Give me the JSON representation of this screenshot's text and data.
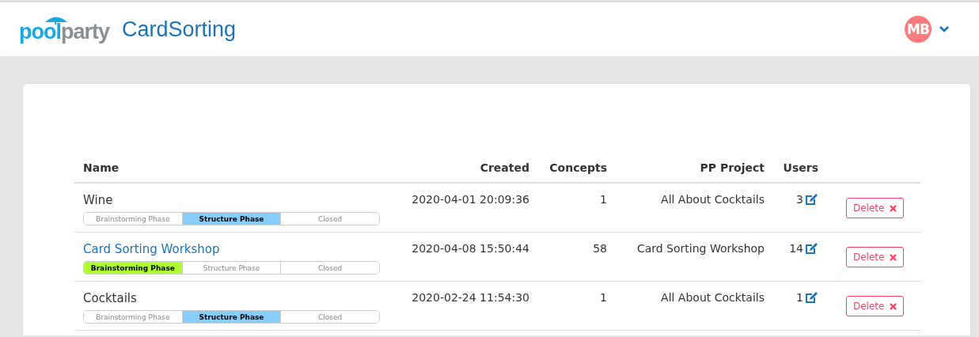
{
  "header": {
    "logo": {
      "part_1": "pool",
      "part_2": "party"
    },
    "app_title": "CardSorting",
    "user": {
      "initials": "MB"
    }
  },
  "table": {
    "columns": [
      "Name",
      "Created",
      "Concepts",
      "PP Project",
      "Users"
    ],
    "rows": [
      {
        "name": "Wine",
        "hovered": false,
        "created": "2020-04-01 20:09:36",
        "concepts": "1",
        "project": "All About Cocktails",
        "users": "3",
        "delete": "Delete",
        "color": "#87cefa",
        "phases": [
          {
            "label": "Brainstorming Phase",
            "selected": false
          },
          {
            "label": "Structure Phase",
            "selected": true
          },
          {
            "label": "Closed",
            "selected": false
          }
        ]
      },
      {
        "name": "Card Sorting Workshop",
        "hovered": true,
        "created": "2020-04-08 15:50:44",
        "concepts": "58",
        "project": "Card Sorting Workshop",
        "users": "14",
        "delete": "Delete",
        "color": "#adff2f",
        "phases": [
          {
            "label": "Brainstorming Phase",
            "selected": true
          },
          {
            "label": "Structure Phase",
            "selected": false
          },
          {
            "label": "Closed",
            "selected": false
          }
        ]
      },
      {
        "name": "Cocktails",
        "hovered": false,
        "created": "2020-02-24 11:54:30",
        "concepts": "1",
        "project": "All About Cocktails",
        "users": "1",
        "delete": "Delete",
        "color": "#87cefa",
        "phases": [
          {
            "label": "Brainstorming Phase",
            "selected": false
          },
          {
            "label": "Structure Phase",
            "selected": true
          },
          {
            "label": "Closed",
            "selected": false
          }
        ]
      }
    ]
  }
}
